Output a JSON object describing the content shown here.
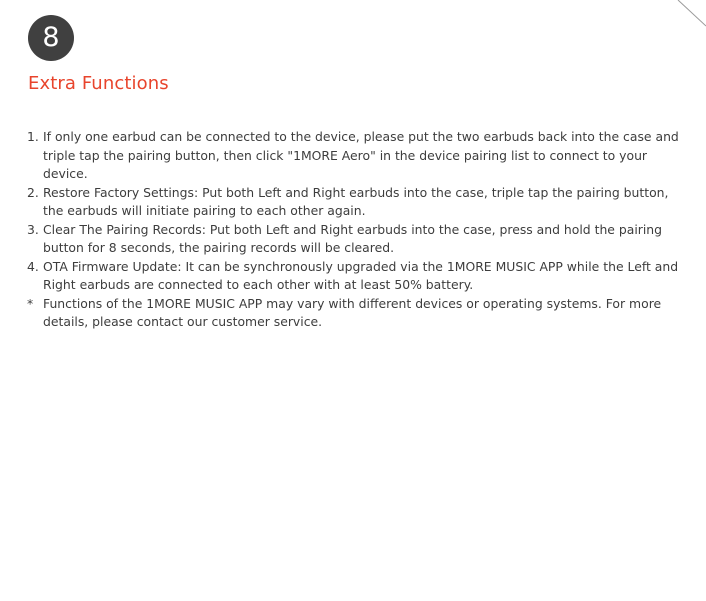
{
  "page": {
    "section_number": "8",
    "title": "Extra Functions",
    "accent_color": "#e8442c",
    "badge_color": "#404040"
  },
  "items": [
    {
      "marker": "1.",
      "text": "If only one earbud can be connected to the device, please put the two earbuds back into the case and triple tap the pairing button, then click \"1MORE Aero\" in the device pairing list to connect to your device."
    },
    {
      "marker": "2.",
      "text": "Restore Factory Settings: Put both Left and Right earbuds into the case, triple tap the pairing button, the earbuds will initiate pairing to each other again."
    },
    {
      "marker": "3.",
      "text": "Clear The Pairing Records: Put both Left and Right earbuds into the case, press and hold the pairing button for 8 seconds, the pairing records will be cleared."
    },
    {
      "marker": "4.",
      "text": "OTA Firmware Update: It can be synchronously upgraded via the 1MORE MUSIC APP while the Left and Right earbuds are connected to each other with at least 50% battery."
    },
    {
      "marker": "*",
      "text": "Functions of the 1MORE MUSIC APP may vary with different devices or operating systems. For more details, please contact our customer service."
    }
  ]
}
